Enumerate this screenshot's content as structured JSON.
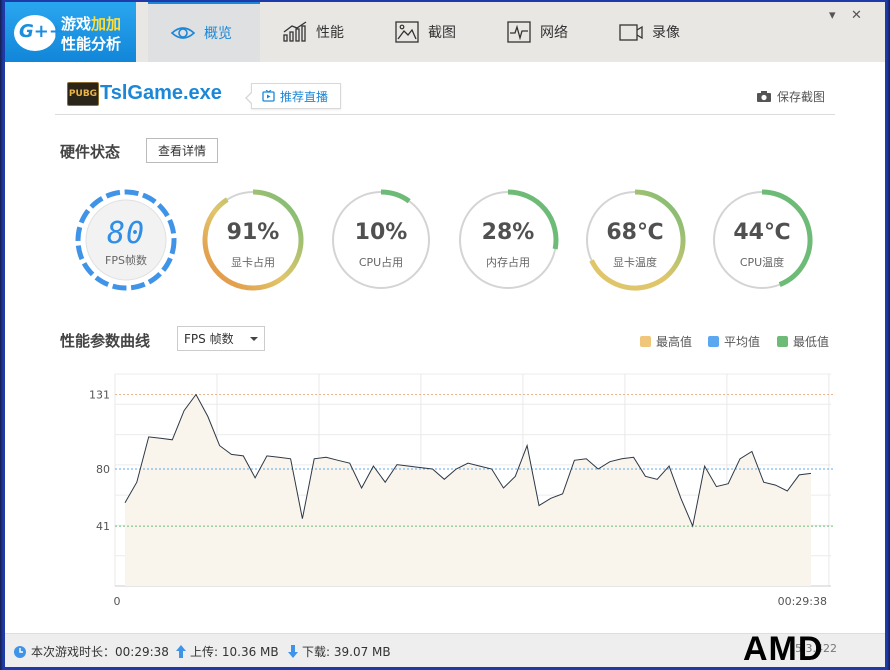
{
  "app": {
    "logo_line1_a": "游戏",
    "logo_line1_b": "加加",
    "logo_line2": "性能分析",
    "logo_badge": "G++"
  },
  "tabs": [
    {
      "label": "概览",
      "icon": "eye-icon",
      "active": true
    },
    {
      "label": "性能",
      "icon": "bar-chart-icon"
    },
    {
      "label": "截图",
      "icon": "image-icon"
    },
    {
      "label": "网络",
      "icon": "pulse-icon"
    },
    {
      "label": "录像",
      "icon": "video-icon"
    }
  ],
  "window_controls": {
    "menu": "▾",
    "close": "✕"
  },
  "game": {
    "badge": "PUBG",
    "title": "TslGame.exe",
    "live_label": "推荐直播",
    "save_shot_label": "保存截图"
  },
  "hardware": {
    "title": "硬件状态",
    "detail_label": "查看详情",
    "gauges": [
      {
        "key": "fps",
        "value": "80",
        "label": "FPS帧数"
      },
      {
        "key": "gpu_usage",
        "value": "91%",
        "label": "显卡占用",
        "fraction": 0.91
      },
      {
        "key": "cpu_usage",
        "value": "10%",
        "label": "CPU占用",
        "fraction": 0.1
      },
      {
        "key": "mem_usage",
        "value": "28%",
        "label": "内存占用",
        "fraction": 0.28
      },
      {
        "key": "gpu_temp",
        "value": "68℃",
        "label": "显卡温度",
        "fraction": 0.68
      },
      {
        "key": "cpu_temp",
        "value": "44℃",
        "label": "CPU温度",
        "fraction": 0.44
      }
    ]
  },
  "curve": {
    "title": "性能参数曲线",
    "select_value": "FPS 帧数",
    "legend": [
      {
        "label": "最高值",
        "color": "#f0c67a"
      },
      {
        "label": "平均值",
        "color": "#5ca8f0"
      },
      {
        "label": "最低值",
        "color": "#6dbb77"
      }
    ]
  },
  "chart_data": {
    "type": "area",
    "x_start_label": "0",
    "x_end_label": "00:29:38",
    "ylim": [
      0,
      145
    ],
    "y_ticks": [
      {
        "value": 131,
        "label": "131"
      },
      {
        "value": 80,
        "label": "80"
      },
      {
        "value": 41,
        "label": "41"
      }
    ],
    "reference_lines": {
      "max": 131,
      "avg": 80,
      "min": 41
    },
    "values": [
      57,
      71,
      102,
      101,
      100,
      120,
      131,
      116,
      96,
      90,
      89,
      74,
      89,
      88,
      87,
      46,
      87,
      88,
      86,
      84,
      67,
      82,
      71,
      83,
      82,
      81,
      80,
      73,
      80,
      84,
      82,
      80,
      67,
      75,
      96,
      55,
      60,
      63,
      86,
      87,
      80,
      85,
      87,
      88,
      75,
      73,
      82,
      60,
      41,
      82,
      68,
      70,
      87,
      92,
      71,
      69,
      65,
      76,
      77
    ]
  },
  "status": {
    "duration": "本次游戏时长：00:29:38",
    "upload": "上传: 10.36 MB",
    "download": "下载: 39.07 MB",
    "version": "5.3.422",
    "brand": "AMD"
  },
  "colors": {
    "accent": "#1c87d6",
    "gauge_track": "#d4d4d4",
    "gauge_good": "#6dbb77",
    "gauge_warn": "#e0c66b",
    "gauge_hot": "#e48a3e",
    "fps_ring": "#3f94e8",
    "area_fill": "#faf5ec",
    "line": "#2c3846"
  }
}
